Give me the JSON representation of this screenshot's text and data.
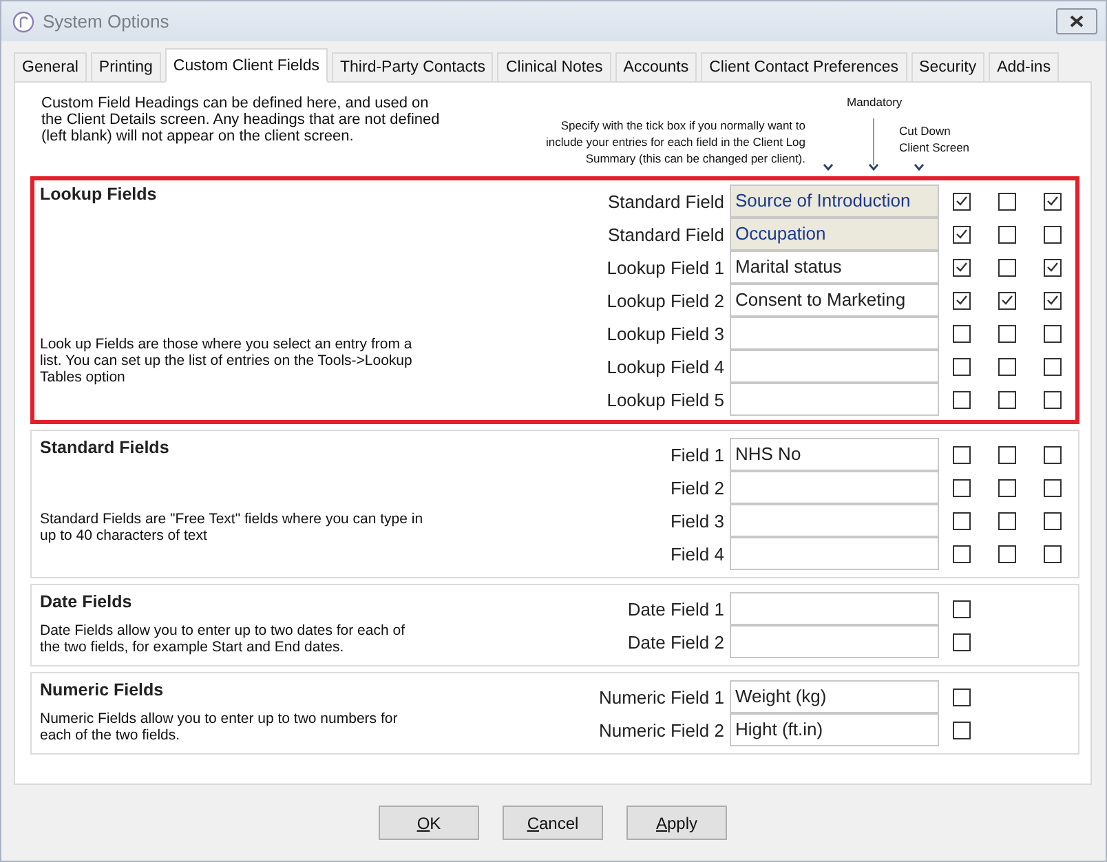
{
  "window": {
    "title": "System Options"
  },
  "tabs": [
    {
      "label": "General",
      "selected": false
    },
    {
      "label": "Printing",
      "selected": false
    },
    {
      "label": "Custom Client Fields",
      "selected": true
    },
    {
      "label": "Third-Party Contacts",
      "selected": false
    },
    {
      "label": "Clinical Notes",
      "selected": false
    },
    {
      "label": "Accounts",
      "selected": false
    },
    {
      "label": "Client Contact Preferences",
      "selected": false
    },
    {
      "label": "Security",
      "selected": false
    },
    {
      "label": "Add-ins",
      "selected": false
    }
  ],
  "intro": "Custom Field Headings can be defined here, and used on the Client Details screen. Any headings that are not defined (left blank) will not appear on the client screen.",
  "column_notes": {
    "summary": "Specify with the tick box if you normally want to include your entries for each field in the Client Log Summary (this can be changed per client).",
    "mandatory": "Mandatory",
    "cut_down": "Cut Down Client Screen"
  },
  "sections": [
    {
      "kind": "lookup",
      "title": "Lookup Fields",
      "highlighted": true,
      "description": "Look up Fields are those where you select an entry from a list. You can set up the list of entries on the Tools->Lookup Tables option",
      "rows": [
        {
          "label": "Standard Field",
          "value": "Source of Introduction",
          "disabled": true,
          "checks": [
            true,
            false,
            true
          ]
        },
        {
          "label": "Standard Field",
          "value": "Occupation",
          "disabled": true,
          "checks": [
            true,
            false,
            false
          ]
        },
        {
          "label": "Lookup Field 1",
          "value": "Marital status",
          "disabled": false,
          "checks": [
            true,
            false,
            true
          ]
        },
        {
          "label": "Lookup Field 2",
          "value": "Consent to Marketing",
          "disabled": false,
          "checks": [
            true,
            true,
            true
          ]
        },
        {
          "label": "Lookup Field 3",
          "disabled": false,
          "checks": [
            false,
            false,
            false
          ]
        },
        {
          "label": "Lookup Field 4",
          "disabled": false,
          "checks": [
            false,
            false,
            false
          ]
        },
        {
          "label": "Lookup Field 5",
          "disabled": false,
          "checks": [
            false,
            false,
            false
          ]
        }
      ]
    },
    {
      "kind": "standard",
      "title": "Standard Fields",
      "highlighted": false,
      "description": "Standard Fields are \"Free Text\" fields where you can type in up to 40 characters of text",
      "rows": [
        {
          "label": "Field 1",
          "value": "NHS No",
          "disabled": false,
          "checks": [
            false,
            false,
            false
          ]
        },
        {
          "label": "Field 2",
          "disabled": false,
          "checks": [
            false,
            false,
            false
          ]
        },
        {
          "label": "Field 3",
          "disabled": false,
          "checks": [
            false,
            false,
            false
          ]
        },
        {
          "label": "Field 4",
          "disabled": false,
          "checks": [
            false,
            false,
            false
          ]
        }
      ]
    },
    {
      "kind": "date",
      "title": "Date Fields",
      "highlighted": false,
      "description": "Date Fields allow you to enter up to two dates for each of the two fields, for example Start and End dates.",
      "rows": [
        {
          "label": "Date Field 1",
          "disabled": false,
          "checks": [
            false
          ]
        },
        {
          "label": "Date Field 2",
          "disabled": false,
          "checks": [
            false
          ]
        }
      ]
    },
    {
      "kind": "numeric",
      "title": "Numeric Fields",
      "highlighted": false,
      "description": "Numeric Fields allow you to enter up to two numbers for each of the two fields.",
      "rows": [
        {
          "label": "Numeric Field 1",
          "value": "Weight (kg)",
          "disabled": false,
          "checks": [
            false
          ]
        },
        {
          "label": "Numeric Field 2",
          "value": "Hight (ft.in)",
          "disabled": false,
          "checks": [
            false
          ]
        }
      ]
    }
  ],
  "buttons": [
    {
      "access_key": "O",
      "rest": "K"
    },
    {
      "access_key": "C",
      "rest": "ancel"
    },
    {
      "access_key": "A",
      "rest": "pply"
    }
  ]
}
